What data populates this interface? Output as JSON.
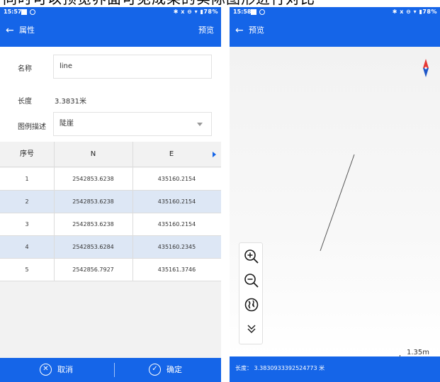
{
  "banner_text": "同时可以预览界面可见成果的实际图形进行对比",
  "left_screen": {
    "status": {
      "time": "15:57",
      "right": "✱ ⅹ ⊖ ▾ ▮78%"
    },
    "appbar": {
      "title": "属性",
      "action": "预览"
    },
    "form": {
      "name_label": "名称",
      "name_value": "line",
      "length_label": "长度",
      "length_value": "3.3831米",
      "legend_label": "图例描述",
      "legend_value": "陡崖"
    },
    "table": {
      "headers": [
        "序号",
        "N",
        "E"
      ],
      "rows": [
        {
          "no": "1",
          "n": "2542853.6238",
          "e": "435160.2154"
        },
        {
          "no": "2",
          "n": "2542853.6238",
          "e": "435160.2154"
        },
        {
          "no": "3",
          "n": "2542853.6238",
          "e": "435160.2154"
        },
        {
          "no": "4",
          "n": "2542853.6284",
          "e": "435160.2345"
        },
        {
          "no": "5",
          "n": "2542856.7927",
          "e": "435161.3746"
        }
      ]
    },
    "bottom": {
      "cancel_label": "取消",
      "confirm_label": "确定"
    }
  },
  "right_screen": {
    "status": {
      "time": "15:58",
      "right": "✱ ⅹ ⊖ ▾ ▮78%"
    },
    "appbar": {
      "title": "预览"
    },
    "map": {
      "scale_label": "1.35m"
    },
    "length_text": "长度：  3.3830933392524773 米"
  },
  "colors": {
    "primary": "#1565e8",
    "row_highlight": "#dde7f5"
  }
}
